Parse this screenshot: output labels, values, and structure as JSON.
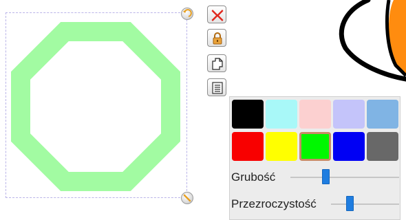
{
  "toolbar": {
    "close": {
      "icon": "close-icon",
      "color": "#e0281e"
    },
    "lock": {
      "icon": "lock-icon",
      "color": "#e8a23a"
    },
    "copy": {
      "icon": "copy-icon"
    },
    "menu": {
      "icon": "menu-icon"
    }
  },
  "shape": {
    "type": "octagon",
    "stroke_color": "#a2fba2"
  },
  "palette": {
    "colors": [
      "#000000",
      "#a8f8f8",
      "#fcd0d0",
      "#c4c4fa",
      "#80b4e4",
      "#f80000",
      "#ffff00",
      "#00f800",
      "#0000f4",
      "#686868"
    ],
    "selected_index": 7
  },
  "sliders": {
    "thickness": {
      "label": "Grubość",
      "value": 0.32
    },
    "opacity": {
      "label": "Przezroczystość",
      "value": 0.27
    }
  }
}
